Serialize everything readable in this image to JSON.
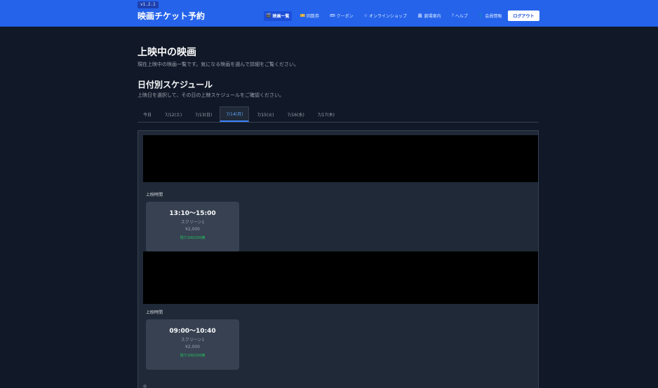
{
  "header": {
    "version": "v1.2.1",
    "app_title": "映画チケット予約",
    "nav": [
      {
        "label": "映画一覧",
        "icon": "🎬"
      },
      {
        "label": "回数券",
        "icon": "🎫"
      },
      {
        "label": "クーポン",
        "icon": "🎟"
      },
      {
        "label": "オンラインショップ",
        "icon": "☆"
      },
      {
        "label": "劇場案内",
        "icon": "🏛"
      },
      {
        "label": "ヘルプ",
        "icon": "?"
      },
      {
        "label": "会員情報",
        "icon": "👤"
      }
    ],
    "logout_label": "ログアウト"
  },
  "main": {
    "title": "上映中の映画",
    "description": "現在上映中の映画一覧です。気になる映画を選んで詳細をご覧ください。",
    "schedule": {
      "title": "日付別スケジュール",
      "description": "上映日を選択して、その日の上映スケジュールをご確認ください。",
      "tabs": [
        {
          "label": "今日"
        },
        {
          "label": "7/12(土)"
        },
        {
          "label": "7/13(日)"
        },
        {
          "label": "7/14(月)"
        },
        {
          "label": "7/15(火)"
        },
        {
          "label": "7/16(水)"
        },
        {
          "label": "7/17(木)"
        }
      ],
      "active_tab": "7/14(月)",
      "movies": [
        {
          "showtime_label": "上映時間",
          "showtimes": [
            {
              "time": "13:10～15:00",
              "screen": "スクリーン1",
              "price": "¥2,000",
              "seats": "残り100/100席"
            }
          ]
        },
        {
          "showtime_label": "上映時間",
          "showtimes": [
            {
              "time": "09:00～10:40",
              "screen": "スクリーン1",
              "price": "¥2,000",
              "seats": "残り100/100席"
            }
          ]
        }
      ]
    }
  },
  "colors": {
    "header_bg": "#2563eb",
    "page_bg": "#111827",
    "panel_bg": "#1f2937",
    "card_bg": "#374151",
    "accent": "#60a5fa",
    "seats_available": "#22c55e"
  }
}
